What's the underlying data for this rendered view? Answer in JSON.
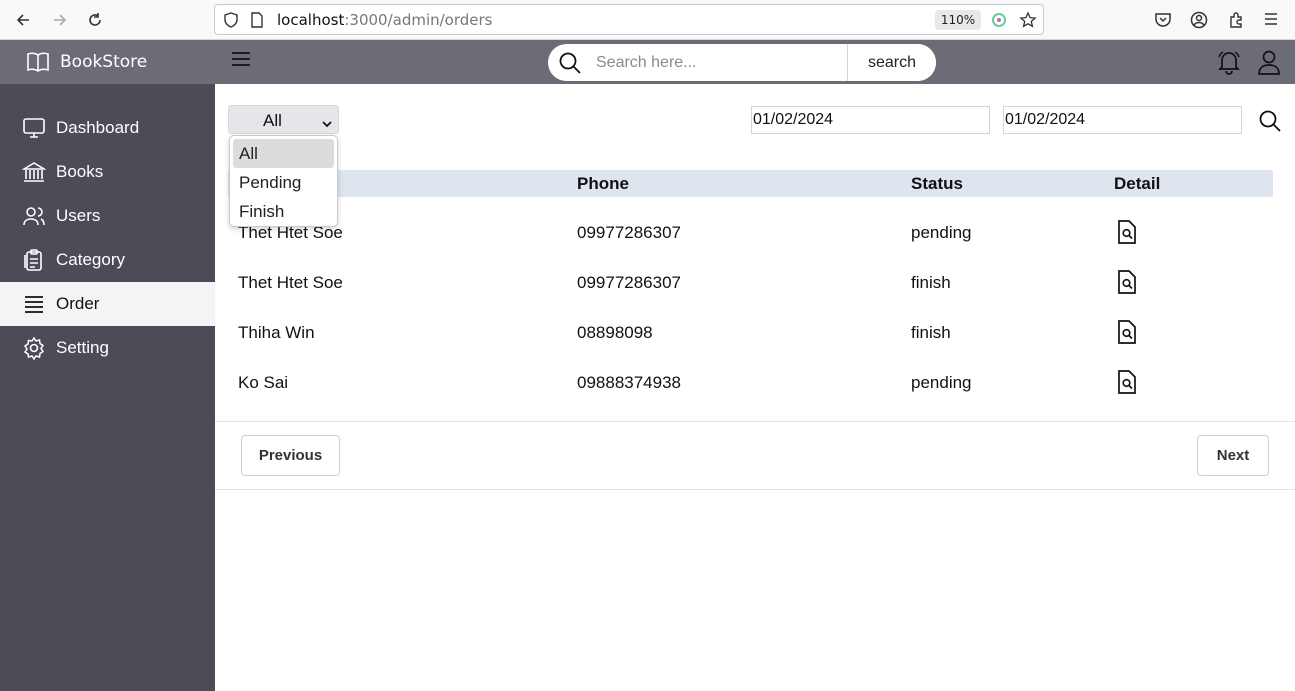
{
  "browser": {
    "url_host": "localhost",
    "url_path": ":3000/admin/orders",
    "zoom": "110%"
  },
  "brand": {
    "name": "BookStore"
  },
  "sidebar": {
    "items": [
      {
        "label": "Dashboard",
        "icon": "monitor-icon",
        "active": false
      },
      {
        "label": "Books",
        "icon": "library-icon",
        "active": false
      },
      {
        "label": "Users",
        "icon": "users-icon",
        "active": false
      },
      {
        "label": "Category",
        "icon": "clipboard-icon",
        "active": false
      },
      {
        "label": "Order",
        "icon": "list-icon",
        "active": true
      },
      {
        "label": "Setting",
        "icon": "gear-icon",
        "active": false
      }
    ]
  },
  "header": {
    "search_placeholder": "Search here...",
    "search_button": "search"
  },
  "filters": {
    "status_selected": "All",
    "status_options": [
      "All",
      "Pending",
      "Finish"
    ],
    "date_from": "01/02/2024",
    "date_to": "01/02/2024"
  },
  "table": {
    "headers": {
      "phone": "Phone",
      "status": "Status",
      "detail": "Detail"
    },
    "rows": [
      {
        "name": "Thet Htet Soe",
        "phone": "09977286307",
        "status": "pending"
      },
      {
        "name": "Thet Htet Soe",
        "phone": "09977286307",
        "status": "finish"
      },
      {
        "name": "Thiha Win",
        "phone": "08898098",
        "status": "finish"
      },
      {
        "name": "Ko Sai",
        "phone": "09888374938",
        "status": "pending"
      }
    ]
  },
  "pagination": {
    "previous": "Previous",
    "next": "Next"
  },
  "colors": {
    "sidebar": "#4b4c56",
    "header": "#6b6c76",
    "table_head": "#dfe5ee"
  }
}
